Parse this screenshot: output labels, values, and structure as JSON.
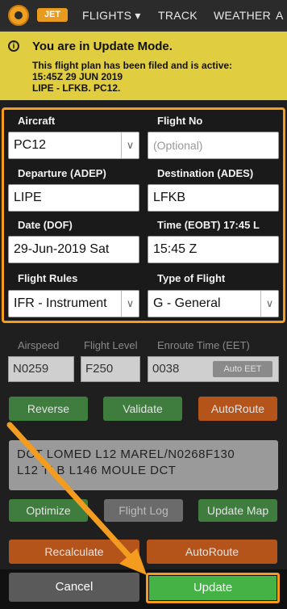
{
  "nav": {
    "brand": "JET",
    "items": [
      {
        "label": "FLIGHTS ▾"
      },
      {
        "label": "TRACK"
      },
      {
        "label": "WEATHER"
      },
      {
        "label": "A"
      }
    ]
  },
  "banner": {
    "icon": "info-icon",
    "title": "You are in Update Mode.",
    "line1": "This flight plan has been filed and is active:",
    "line2": "15:45Z 29 JUN 2019",
    "line3": "LIPE - LFKB. PC12."
  },
  "form": {
    "aircraft": {
      "label": "Aircraft",
      "value": "PC12"
    },
    "flight_no": {
      "label": "Flight No",
      "placeholder": "(Optional)"
    },
    "departure": {
      "label": "Departure (ADEP)",
      "value": "LIPE"
    },
    "destination": {
      "label": "Destination (ADES)",
      "value": "LFKB"
    },
    "date": {
      "label": "Date (DOF)",
      "value": "29-Jun-2019 Sat"
    },
    "time": {
      "label": "Time (EOBT) 17:45 L",
      "value": "15:45 Z"
    },
    "flight_rules": {
      "label": "Flight Rules",
      "value": "IFR - Instrument"
    },
    "flight_type": {
      "label": "Type of Flight",
      "value": "G - General"
    }
  },
  "route_section": {
    "airspeed": {
      "label": "Airspeed",
      "value": "N0259"
    },
    "flight_level": {
      "label": "Flight Level",
      "value": "F250"
    },
    "eet": {
      "label": "Enroute Time (EET)",
      "value": "0038",
      "auto_label": "Auto EET"
    },
    "buttons1": {
      "reverse": "Reverse",
      "validate": "Validate",
      "autoroute": "AutoRoute"
    },
    "route_line1": "DCT LOMED L12 MAREL/N0268F130",
    "route_line2": "L12 TLB L146 MOULE DCT",
    "buttons2": {
      "optimize": "Optimize",
      "flight_log": "Flight Log",
      "update_map": "Update Map"
    },
    "buttons3": {
      "recalculate": "Recalculate",
      "autoroute": "AutoRoute"
    }
  },
  "footer": {
    "cancel": "Cancel",
    "update": "Update"
  },
  "colors": {
    "accent": "#f39c1f",
    "banner": "#e1cd40",
    "update": "#44b244"
  }
}
